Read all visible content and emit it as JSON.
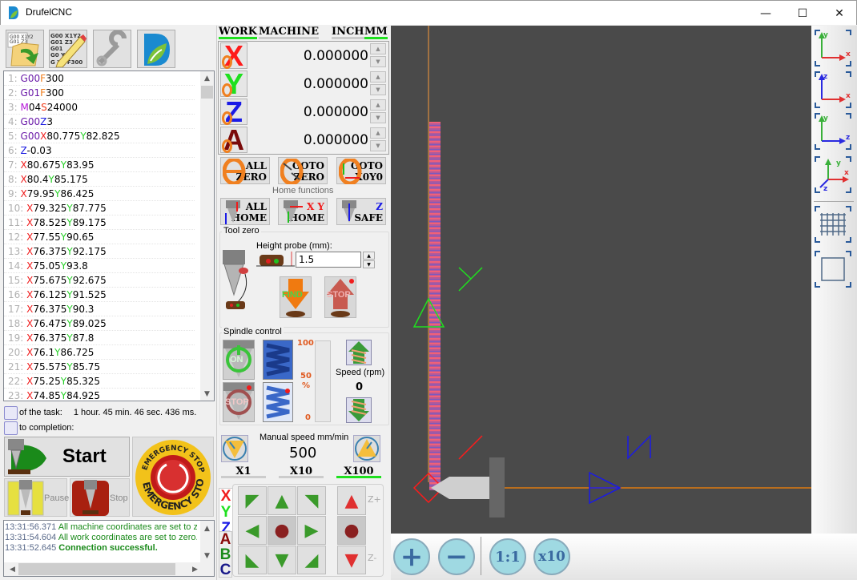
{
  "window": {
    "title": "DrufelCNC",
    "minimize": "—",
    "maximize": "☐",
    "close": "✕"
  },
  "toolbar": {
    "open_file_tooltip": "open-gcode",
    "edit_file_tooltip": "edit-gcode",
    "settings_tooltip": "settings",
    "about_tooltip": "about"
  },
  "gcode": {
    "lines": [
      {
        "n": "1:",
        "parts": [
          [
            "G",
            "G00"
          ],
          [
            "F",
            "F"
          ],
          [
            "N",
            "300"
          ]
        ]
      },
      {
        "n": "2:",
        "parts": [
          [
            "G",
            "G01"
          ],
          [
            "F",
            "F"
          ],
          [
            "N",
            "300"
          ]
        ]
      },
      {
        "n": "3:",
        "parts": [
          [
            "M",
            "M"
          ],
          [
            "N",
            "04"
          ],
          [
            "S",
            "S"
          ],
          [
            "N",
            "24000"
          ]
        ]
      },
      {
        "n": "4:",
        "parts": [
          [
            "G",
            "G00"
          ],
          [
            "Z",
            "Z"
          ],
          [
            "N",
            "3"
          ]
        ]
      },
      {
        "n": "5:",
        "parts": [
          [
            "G",
            "G00"
          ],
          [
            "X",
            "X"
          ],
          [
            "N",
            "80.775"
          ],
          [
            "Y",
            "Y"
          ],
          [
            "N",
            "82.825"
          ]
        ]
      },
      {
        "n": "6:",
        "parts": [
          [
            "Z",
            "Z"
          ],
          [
            "N",
            "-0.03"
          ]
        ]
      },
      {
        "n": "7:",
        "parts": [
          [
            "X",
            "X"
          ],
          [
            "N",
            "80.675"
          ],
          [
            "Y",
            "Y"
          ],
          [
            "N",
            "83.95"
          ]
        ]
      },
      {
        "n": "8:",
        "parts": [
          [
            "X",
            "X"
          ],
          [
            "N",
            "80.4"
          ],
          [
            "Y",
            "Y"
          ],
          [
            "N",
            "85.175"
          ]
        ]
      },
      {
        "n": "9:",
        "parts": [
          [
            "X",
            "X"
          ],
          [
            "N",
            "79.95"
          ],
          [
            "Y",
            "Y"
          ],
          [
            "N",
            "86.425"
          ]
        ]
      },
      {
        "n": "10:",
        "parts": [
          [
            "X",
            " X"
          ],
          [
            "N",
            "79.325"
          ],
          [
            "Y",
            "Y"
          ],
          [
            "N",
            "87.775"
          ]
        ]
      },
      {
        "n": "11:",
        "parts": [
          [
            "X",
            " X"
          ],
          [
            "N",
            "78.525"
          ],
          [
            "Y",
            "Y"
          ],
          [
            "N",
            "89.175"
          ]
        ]
      },
      {
        "n": "12:",
        "parts": [
          [
            "X",
            " X"
          ],
          [
            "N",
            "77.55"
          ],
          [
            "Y",
            "Y"
          ],
          [
            "N",
            "90.65"
          ]
        ]
      },
      {
        "n": "13:",
        "parts": [
          [
            "X",
            " X"
          ],
          [
            "N",
            "76.375"
          ],
          [
            "Y",
            "Y"
          ],
          [
            "N",
            "92.175"
          ]
        ]
      },
      {
        "n": "14:",
        "parts": [
          [
            "X",
            " X"
          ],
          [
            "N",
            "75.05"
          ],
          [
            "Y",
            "Y"
          ],
          [
            "N",
            "93.8"
          ]
        ]
      },
      {
        "n": "15:",
        "parts": [
          [
            "X",
            " X"
          ],
          [
            "N",
            "75.675"
          ],
          [
            "Y",
            "Y"
          ],
          [
            "N",
            "92.675"
          ]
        ]
      },
      {
        "n": "16:",
        "parts": [
          [
            "X",
            " X"
          ],
          [
            "N",
            "76.125"
          ],
          [
            "Y",
            "Y"
          ],
          [
            "N",
            "91.525"
          ]
        ]
      },
      {
        "n": "17:",
        "parts": [
          [
            "X",
            " X"
          ],
          [
            "N",
            "76.375"
          ],
          [
            "Y",
            "Y"
          ],
          [
            "N",
            "90.3"
          ]
        ]
      },
      {
        "n": "18:",
        "parts": [
          [
            "X",
            " X"
          ],
          [
            "N",
            "76.475"
          ],
          [
            "Y",
            "Y"
          ],
          [
            "N",
            "89.025"
          ]
        ]
      },
      {
        "n": "19:",
        "parts": [
          [
            "X",
            " X"
          ],
          [
            "N",
            "76.375"
          ],
          [
            "Y",
            "Y"
          ],
          [
            "N",
            "87.8"
          ]
        ]
      },
      {
        "n": "20:",
        "parts": [
          [
            "X",
            " X"
          ],
          [
            "N",
            "76.1"
          ],
          [
            "Y",
            "Y"
          ],
          [
            "N",
            "86.725"
          ]
        ]
      },
      {
        "n": "21:",
        "parts": [
          [
            "X",
            " X"
          ],
          [
            "N",
            "75.575"
          ],
          [
            "Y",
            "Y"
          ],
          [
            "N",
            "85.75"
          ]
        ]
      },
      {
        "n": "22:",
        "parts": [
          [
            "X",
            " X"
          ],
          [
            "N",
            "75.25"
          ],
          [
            "Y",
            "Y"
          ],
          [
            "N",
            "85.325"
          ]
        ]
      },
      {
        "n": "23:",
        "parts": [
          [
            "X",
            " X"
          ],
          [
            "N",
            "74.85"
          ],
          [
            "Y",
            "Y"
          ],
          [
            "N",
            "84.925"
          ]
        ]
      }
    ]
  },
  "task": {
    "duration_label": "of the task:",
    "duration_value": "1 hour. 45 min. 46 sec. 436 ms.",
    "completion_label": "to completion:",
    "completion_value": ""
  },
  "controls": {
    "start": "Start",
    "pause": "Pause",
    "stop": "Stop",
    "emergency_top": "EMERGENCY STOP",
    "emergency_bottom": "EMERGENCY STOP"
  },
  "log": {
    "entries": [
      {
        "time": "13:31:56.371",
        "msg": "All machine coordinates are set to ze",
        "bold": false
      },
      {
        "time": "13:31:54.604",
        "msg": "All work coordinates are set to zero.",
        "bold": false
      },
      {
        "time": "13:31:52.645",
        "msg": "Connection successful.",
        "bold": true
      }
    ]
  },
  "coords": {
    "tabs": {
      "work": "WORK",
      "machine": "MACHINE",
      "inch": "INCH",
      "mm": "MM",
      "active_mode": "WORK",
      "active_unit": "MM"
    },
    "axes": [
      {
        "axis": "X",
        "value": "0.000000",
        "color": "#ff1a1a"
      },
      {
        "axis": "Y",
        "value": "0.000000",
        "color": "#1fe01f"
      },
      {
        "axis": "Z",
        "value": "0.000000",
        "color": "#1a1ae6"
      },
      {
        "axis": "A",
        "value": "0.000000",
        "color": "#7a0a0a"
      }
    ]
  },
  "zero_buttons": [
    {
      "l1": "ALL",
      "l2": "ZERO"
    },
    {
      "l1": "GOTO",
      "l2": "ZERO"
    },
    {
      "l1": "GOTO",
      "l2": "X0Y0"
    }
  ],
  "home": {
    "label": "Home functions",
    "buttons": [
      {
        "l1": "ALL",
        "l2": "HOME"
      },
      {
        "l1": "X Y",
        "l2": "HOME"
      },
      {
        "l1": "Z",
        "l2": "SAFE"
      }
    ]
  },
  "tool_zero": {
    "label": "Tool zero",
    "probe_label": "Height probe (mm):",
    "probe_value": "1.5",
    "find": "FIND",
    "stop": "STOP"
  },
  "spindle": {
    "label": "Spindle control",
    "on": "ON",
    "stop": "STOP",
    "scale_100": "100",
    "scale_50": "50",
    "scale_pct": "%",
    "scale_0": "0",
    "speed_label": "Speed (rpm)",
    "speed_value": "0",
    "override_percent": 0
  },
  "manual": {
    "label": "Manual speed mm/min",
    "value": "500",
    "multipliers": [
      "X1",
      "X10",
      "X100"
    ],
    "active_multiplier": "X100"
  },
  "jog": {
    "tab_xyz": [
      "X",
      "Y",
      "Z"
    ],
    "tab_abc": [
      "A",
      "B",
      "C"
    ],
    "z_plus": "Z+",
    "z_minus": "Z-"
  },
  "viewport": {
    "axis_label_y": "Y",
    "axis_label_x": "X",
    "axis_label_z": "Z",
    "colors": {
      "background": "#4a4a4a",
      "path": "#e0608a",
      "guide": "#e07a10",
      "x": "#ff1a1a",
      "y": "#1fe01f",
      "z": "#1a1ae6"
    }
  },
  "view_buttons": [
    "view-xy",
    "view-xz",
    "view-yz",
    "view-3d",
    "grid-toggle",
    "fit-view"
  ],
  "zoom_buttons": {
    "in": "+",
    "out": "−",
    "one": "1:1",
    "ten": "x10"
  }
}
